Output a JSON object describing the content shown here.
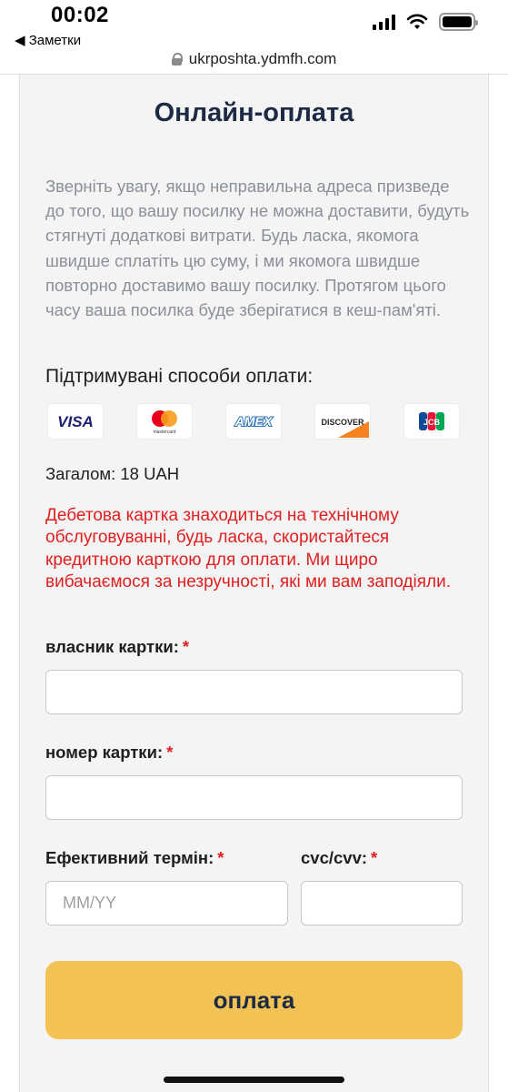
{
  "status": {
    "time": "00:02",
    "back_label": "◀ Заметки"
  },
  "browser": {
    "url": "ukrposhta.ydmfh.com"
  },
  "page": {
    "title": "Онлайн-оплата",
    "notice": "Зверніть увагу, якщо неправильна адреса призведе до того, що вашу посилку не можна доставити, будуть стягнуті додаткові витрати. Будь ласка, якомога швидше сплатіть цю суму, і ми якомога швидше повторно доставимо вашу посилку. Протягом цього часу ваша посилка буде зберігатися в кеш-пам'яті.",
    "methods_label": "Підтримувані способи оплати:",
    "card_brands": [
      "VISA",
      "mastercard",
      "AMEX",
      "DISCOVER",
      "JCB"
    ],
    "total": "Загалом: 18 UAH",
    "error": "Дебетова картка знаходиться на технічному обслуговуванні, будь ласка, скористайтеся кредитною карткою для оплати. Ми щиро вибачаємося за незручності, які ми вам заподіяли."
  },
  "form": {
    "required_mark": "*",
    "holder_label": "власник картки:",
    "holder_value": "",
    "number_label": "номер картки:",
    "number_value": "",
    "expiry_label": "Ефективний термін:",
    "expiry_placeholder": "MM/YY",
    "cvc_label": "cvc/cvv:",
    "cvc_value": "",
    "submit_label": "оплата"
  },
  "colors": {
    "accent": "#f2c354",
    "title": "#1d2a44",
    "error": "#e02020",
    "notice": "#8a8f99"
  }
}
